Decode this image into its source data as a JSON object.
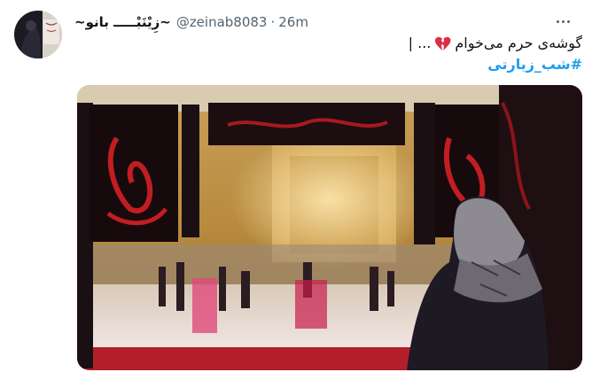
{
  "author": {
    "display_name": "~زِیْنَبْـــــ بانو~",
    "handle": "@zeinab8083",
    "time": "26m"
  },
  "tweet": {
    "text": "گوشه‌ی حرم می‌خوام",
    "emoji": "broken-heart-icon",
    "trailing": "... |",
    "hashtag": "#شب_زیارتی"
  },
  "colors": {
    "hashtag": "#1d9bf0",
    "muted": "#536471",
    "heart": "#dd2e44"
  }
}
